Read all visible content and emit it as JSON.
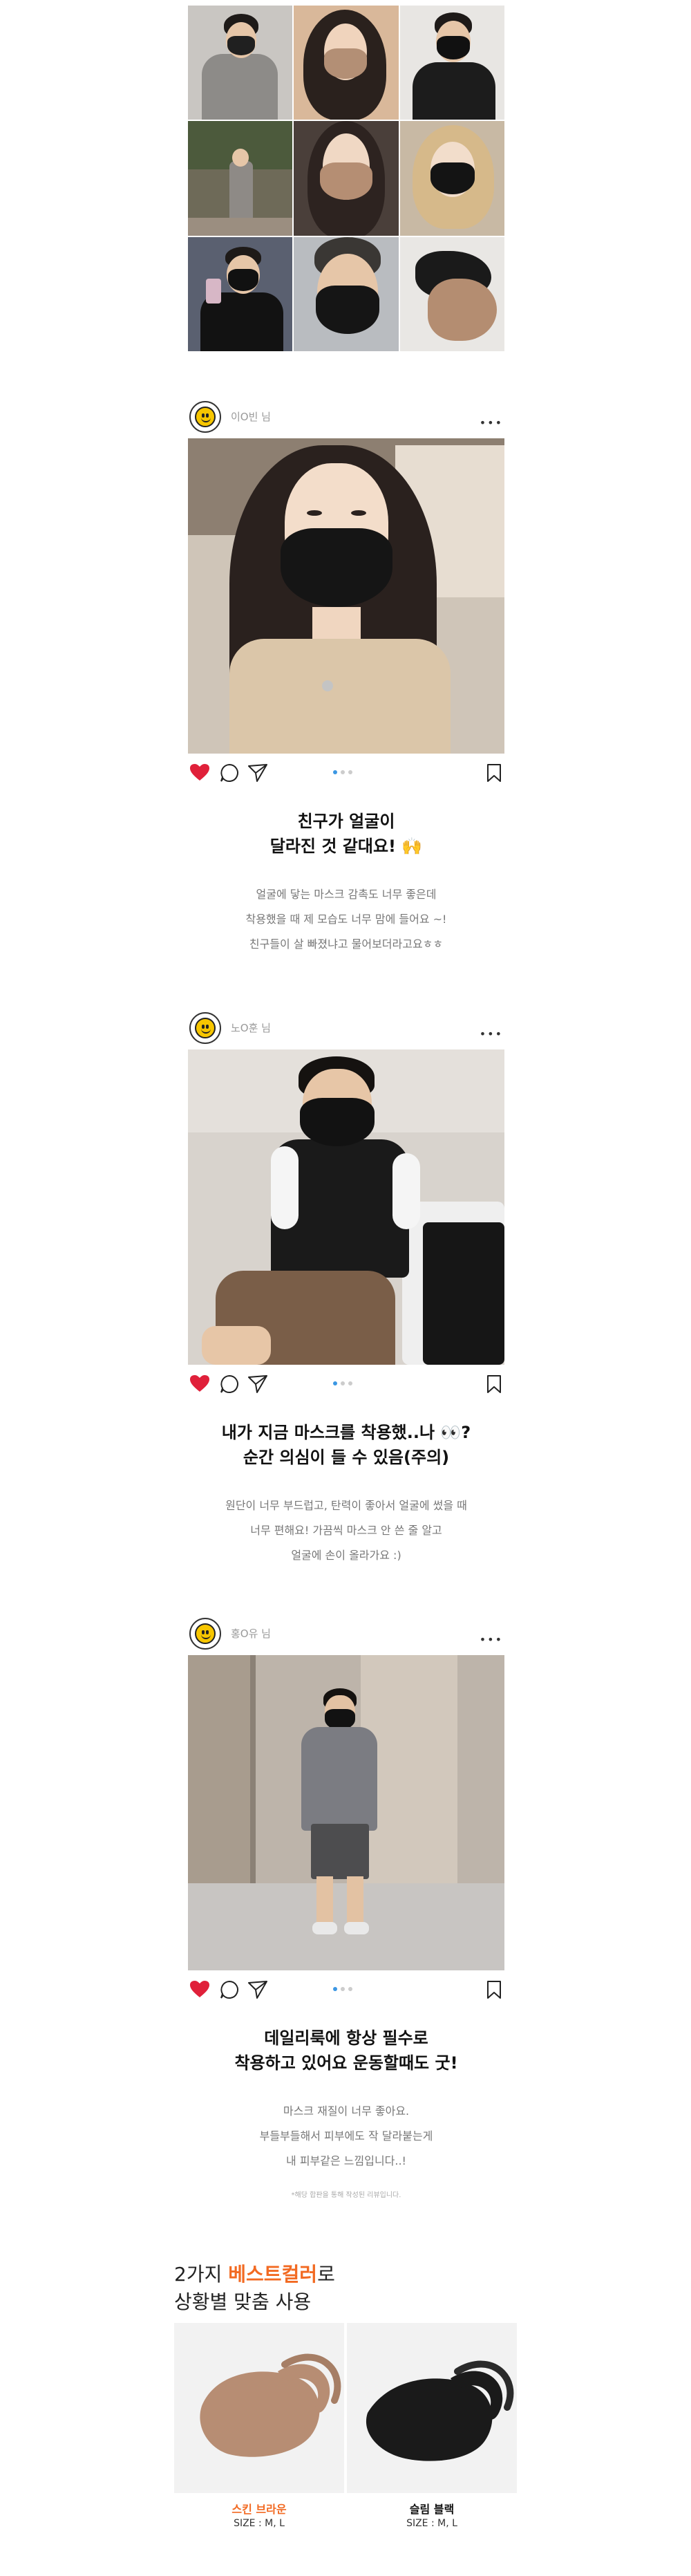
{
  "colors": {
    "accent": "#f26a22",
    "heart": "#e0203a",
    "dot_active": "#3b97e3",
    "skin_brown": "#b78d73",
    "black": "#1a1a1a"
  },
  "reviews": [
    {
      "username": "이O빈 님",
      "headline_1": "친구가 얼굴이",
      "headline_2": "달라진 것 같대요! 🙌",
      "body_1": "얼굴에 닿는 마스크 감촉도 너무 좋은데",
      "body_2": "착용했을 때 제 모습도 너무 맘에 들어요 ~!",
      "body_3": "친구들이 살 빠졌냐고 물어보더라고요ㅎㅎ"
    },
    {
      "username": "노O훈 님",
      "headline_1": "내가 지금 마스크를 착용했..나 👀?",
      "headline_2": "순간 의심이 들 수 있음(주의)",
      "body_1": "원단이 너무 부드럽고, 탄력이 좋아서 얼굴에 썼을 때",
      "body_2": "너무 편해요! 가끔씩 마스크 안 쓴 줄 알고",
      "body_3": "얼굴에 손이 올라가요 :)"
    },
    {
      "username": "홍O유 님",
      "headline_1": "데일리룩에 항상 필수로",
      "headline_2": "착용하고 있어요 운동할때도 굿!",
      "body_1": "마스크 재질이 너무 좋아요.",
      "body_2": "부들부들해서 피부에도 작 달라붙는게",
      "body_3": "내 피부같은 느낌입니다..!"
    }
  ],
  "footnote": "*해당 합판을 통해 작성된 리뷰입니다.",
  "color_section": {
    "title_pre": "2가지 ",
    "title_accent": "베스트컬러",
    "title_post": "로",
    "subtitle": "상황별 맞춤 사용",
    "options": [
      {
        "name": "스킨 브라운",
        "size": "SIZE : M, L",
        "name_color": "#f26a22"
      },
      {
        "name": "슬림 블랙",
        "size": "SIZE : M, L",
        "name_color": "#111111"
      }
    ]
  },
  "icons": [
    "heart-icon",
    "comment-icon",
    "share-icon",
    "bookmark-icon",
    "more-icon",
    "smiley-avatar-icon"
  ]
}
